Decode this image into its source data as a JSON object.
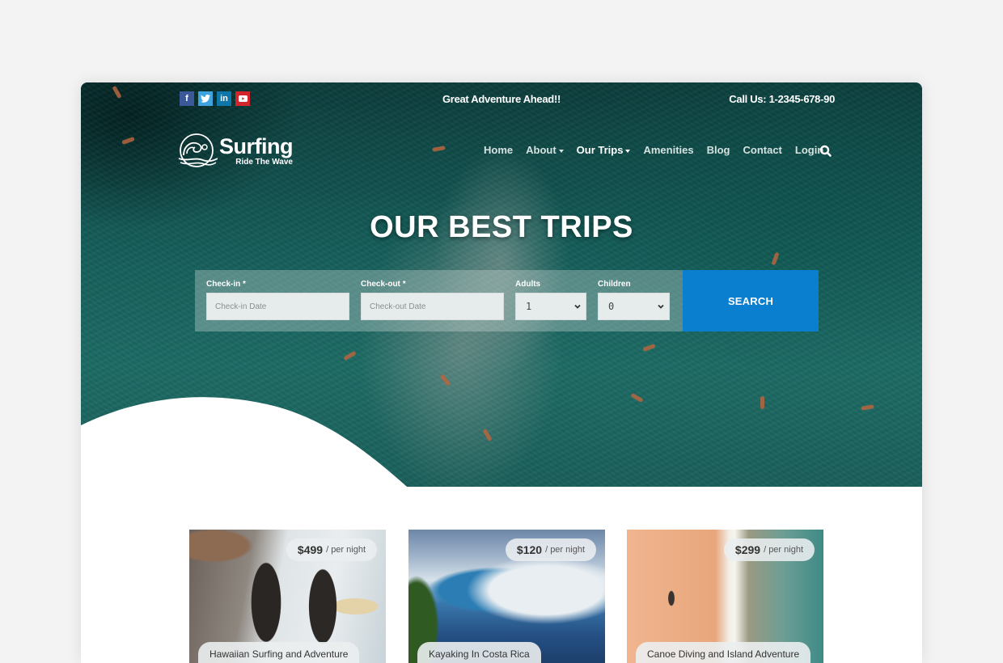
{
  "topbar": {
    "social": [
      {
        "name": "facebook",
        "glyph": "f"
      },
      {
        "name": "twitter",
        "glyph": "t"
      },
      {
        "name": "linkedin",
        "glyph": "in"
      },
      {
        "name": "youtube",
        "glyph": "▶"
      }
    ],
    "tagline": "Great Adventure Ahead!!",
    "call_us": "Call Us: 1-2345-678-90"
  },
  "logo": {
    "title": "Surfing",
    "subtitle": "Ride The Wave",
    "icon": "wave-logo-icon"
  },
  "nav": {
    "items": [
      {
        "label": "Home",
        "dropdown": false,
        "active": false
      },
      {
        "label": "About",
        "dropdown": true,
        "active": false
      },
      {
        "label": "Our Trips",
        "dropdown": true,
        "active": true
      },
      {
        "label": "Amenities",
        "dropdown": false,
        "active": false
      },
      {
        "label": "Blog",
        "dropdown": false,
        "active": false
      },
      {
        "label": "Contact",
        "dropdown": false,
        "active": false
      },
      {
        "label": "Login",
        "dropdown": false,
        "active": false
      }
    ],
    "search_icon": "search-icon"
  },
  "hero": {
    "title": "OUR BEST TRIPS"
  },
  "booking": {
    "checkin": {
      "label": "Check-in",
      "required": "*",
      "placeholder": "Check-in Date",
      "value": ""
    },
    "checkout": {
      "label": "Check-out",
      "required": "*",
      "placeholder": "Check-out Date",
      "value": ""
    },
    "adults": {
      "label": "Adults",
      "value": "1"
    },
    "children": {
      "label": "Children",
      "value": "0"
    },
    "search_label": "SEARCH"
  },
  "trips": [
    {
      "price": "$499",
      "per": "/ per night",
      "name": "Hawaiian Surfing and Adventure"
    },
    {
      "price": "$120",
      "per": "/ per night",
      "name": "Kayaking In Costa Rica"
    },
    {
      "price": "$299",
      "per": "/ per night",
      "name": "Canoe Diving and Island Adventure"
    }
  ],
  "colors": {
    "accent": "#0b7fcf",
    "hero": "#145c58",
    "facebook": "#3b5998",
    "twitter": "#3fa3e0",
    "linkedin": "#0e76a8",
    "youtube": "#d2262c"
  }
}
